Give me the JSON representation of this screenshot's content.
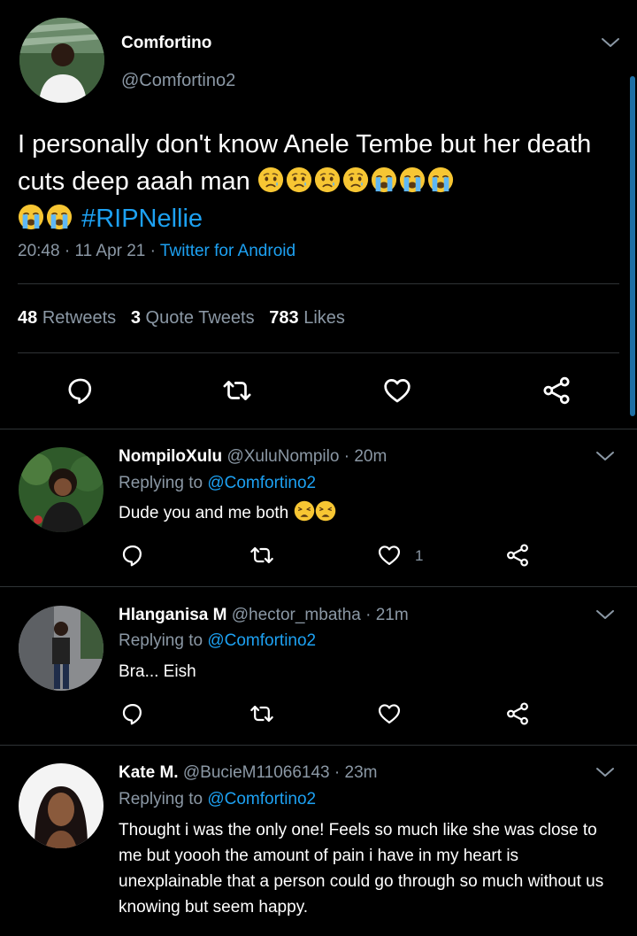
{
  "main_tweet": {
    "name": "Comfortino",
    "handle": "@Comfortino2",
    "text": "I personally don't know Anele Tembe but her death cuts deep aaah man",
    "hashtag": "#RIPNellie",
    "time": "20:48",
    "date": "11 Apr 21",
    "source": "Twitter for Android",
    "retweets_count": "48",
    "retweets_label": "Retweets",
    "quotes_count": "3",
    "quotes_label": "Quote Tweets",
    "likes_count": "783",
    "likes_label": "Likes",
    "emojis": [
      "crying-face",
      "crying-face",
      "crying-face",
      "crying-face",
      "loudly-crying-face",
      "loudly-crying-face",
      "loudly-crying-face",
      "loudly-crying-face",
      "loudly-crying-face"
    ]
  },
  "replies": [
    {
      "name": "NompiloXulu",
      "handle": "@XuluNompilo",
      "age": "20m",
      "replying_label": "Replying to",
      "replying_to": "@Comfortino2",
      "text": "Dude you and me both",
      "emojis": [
        "weary-face",
        "weary-face"
      ],
      "like_count": "1"
    },
    {
      "name": "Hlanganisa M",
      "handle": "@hector_mbatha",
      "age": "21m",
      "replying_label": "Replying to",
      "replying_to": "@Comfortino2",
      "text": "Bra... Eish"
    },
    {
      "name": "Kate M.",
      "handle": "@BucieM11066143",
      "age": "23m",
      "replying_label": "Replying to",
      "replying_to": "@Comfortino2",
      "text": "Thought i was the only one! Feels so much like she was close to me but yoooh the amount of pain i have in my heart is unexplainable that a person could go through so much without us knowing but seem happy."
    }
  ],
  "colors": {
    "background": "#000000",
    "text": "#ffffff",
    "secondary": "#8b98a5",
    "link": "#1da1f2",
    "divider": "#2f3336"
  },
  "icons": [
    "reply-icon",
    "retweet-icon",
    "like-icon",
    "share-icon",
    "chevron-down-icon"
  ]
}
